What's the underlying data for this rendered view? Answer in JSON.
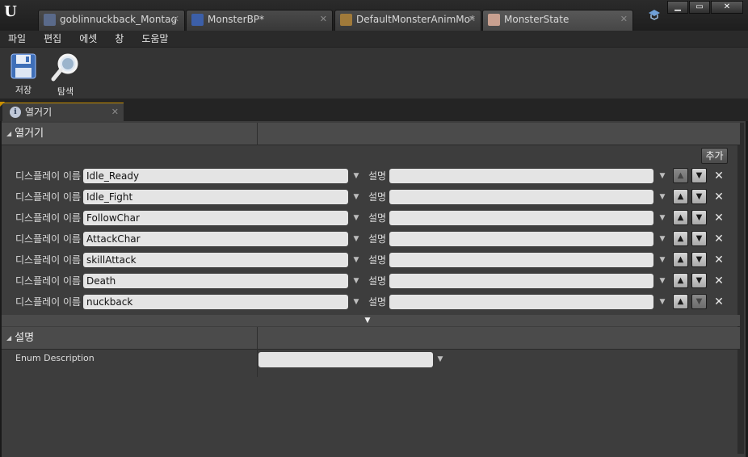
{
  "tabs": [
    {
      "label": "goblinnuckback_Montag",
      "icon": "animation-montage-icon",
      "icon_color": "#5a6a8a",
      "active": false
    },
    {
      "label": "MonsterBP*",
      "icon": "blueprint-icon",
      "icon_color": "#3c5fa8",
      "active": false
    },
    {
      "label": "DefaultMonsterAnimMo*",
      "icon": "animation-blueprint-icon",
      "icon_color": "#a07a3a",
      "active": false
    },
    {
      "label": "MonsterState",
      "icon": "enum-icon",
      "icon_color": "#c8a090",
      "active": true
    }
  ],
  "window_buttons": {
    "minimize": "▁",
    "maximize": "▭",
    "close": "✕"
  },
  "menu": [
    "파일",
    "편집",
    "에셋",
    "창",
    "도움말"
  ],
  "toolbar": {
    "save_label": "저장",
    "browse_label": "탐색"
  },
  "details_tab": {
    "label": "열거기",
    "icon": "i"
  },
  "categories": {
    "enumerators": "열거기",
    "description": "설명"
  },
  "add_label": "추가",
  "display_name_label": "디스플레이 이름",
  "desc_label": "설명",
  "enumerators": [
    {
      "display_name": "Idle_Ready",
      "description": ""
    },
    {
      "display_name": "Idle_Fight",
      "description": ""
    },
    {
      "display_name": "FollowChar",
      "description": ""
    },
    {
      "display_name": "AttackChar",
      "description": ""
    },
    {
      "display_name": "skillAttack",
      "description": ""
    },
    {
      "display_name": "Death",
      "description": ""
    },
    {
      "display_name": "nuckback",
      "description": ""
    }
  ],
  "enum_description": {
    "label": "Enum Description",
    "value": ""
  },
  "glyphs": {
    "dropdown": "▼",
    "up": "▲",
    "down": "▼",
    "delete": "✕",
    "tab_close": "✕",
    "expand": "▼"
  }
}
